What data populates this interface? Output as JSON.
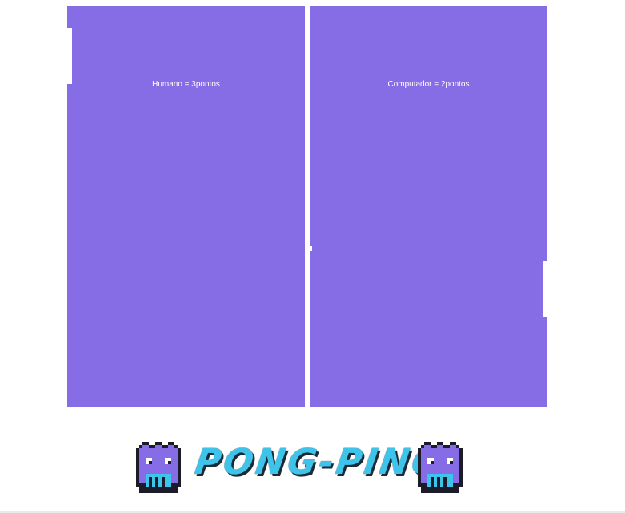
{
  "game": {
    "player_score_text": "Humano = 3pontos",
    "computer_score_text": "Computador = 2pontos",
    "player_score": 3,
    "computer_score": 2
  },
  "logo": {
    "title": "PONG-PING",
    "mascot_icon": "pixel-monster-icon"
  },
  "colors": {
    "court": "#876de5",
    "paddles": "#ffffff",
    "title": "#3ec3ea"
  }
}
